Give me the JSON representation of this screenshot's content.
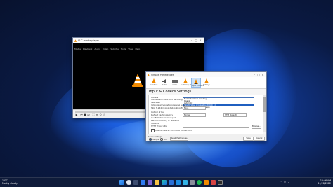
{
  "colors": {
    "accent": "#1f5fc0",
    "vlc_orange": "#f08a00",
    "taskbar": "#101c3a"
  },
  "player": {
    "title": "VLC media player",
    "menu": [
      "Media",
      "Playback",
      "Audio",
      "Video",
      "Subtitle",
      "Tools",
      "View",
      "Help"
    ],
    "controls": [
      "play",
      "previous",
      "stop",
      "next",
      "fullscreen",
      "playlist",
      "loop",
      "shuffle"
    ],
    "volume": "100%",
    "progress": 0
  },
  "prefs": {
    "title": "Simple Preferences",
    "categories": [
      {
        "label": "Interface",
        "icon": "interface-icon"
      },
      {
        "label": "Audio",
        "icon": "audio-icon"
      },
      {
        "label": "Video",
        "icon": "video-icon"
      },
      {
        "label": "Subtitles / OSD",
        "icon": "subtitles-icon"
      },
      {
        "label": "Input / Codecs",
        "icon": "codecs-icon"
      },
      {
        "label": "Hotkeys",
        "icon": "hotkeys-icon"
      }
    ],
    "section_title": "Input & Codecs Settings",
    "codecs_label": "Codecs",
    "hw_label": "Hardware-accelerated decoding",
    "hw_value": "Enable hardware decoding",
    "dropdown_options": [
      "Disable",
      "Automatic",
      "DirectX Video Acceleration (DXVA) 2.0",
      "Direct3D11 Video Acceleration"
    ],
    "fast_seek_label": "Fast seek",
    "video_quality_label": "Video quality post-processing level",
    "skip_h264_label": "Skip H.264 in-loop deblocking filter",
    "skip_h264_value": "None",
    "disc_label": "Optical drive",
    "default_caching_label": "Default caching policy",
    "default_caching_value": "Normal",
    "rtsp_label": "Live555 stream transport",
    "rtsp_value": "HTTP (default)",
    "cache_label": "Record directory or filename",
    "network_label": "Network",
    "proxy_label": "HTTP Proxy URL",
    "ffmpeg_label": "Use hardware YUV->RGB conversions",
    "browse_label": "Browse...",
    "show_settings_label": "Show settings",
    "simple_label": "Simple",
    "all_label": "All",
    "reset_label": "Reset Preferences",
    "save_label": "Save",
    "cancel_label": "Cancel",
    "avi_label": "Damaged or incomplete AVI file",
    "avi_value": "Ask for action",
    "preferred_label": "Preferred Subtitles"
  },
  "taskbar": {
    "weather_temp": "15°C",
    "weather_text": "Mostly cloudy",
    "time": "10:46 AM",
    "date": "11/28/2022",
    "apps": [
      "start",
      "search",
      "task-view",
      "widgets",
      "chat",
      "explorer",
      "edge",
      "store",
      "mail",
      "photos",
      "settings",
      "spotify",
      "vlc",
      "media",
      "terminal"
    ]
  }
}
